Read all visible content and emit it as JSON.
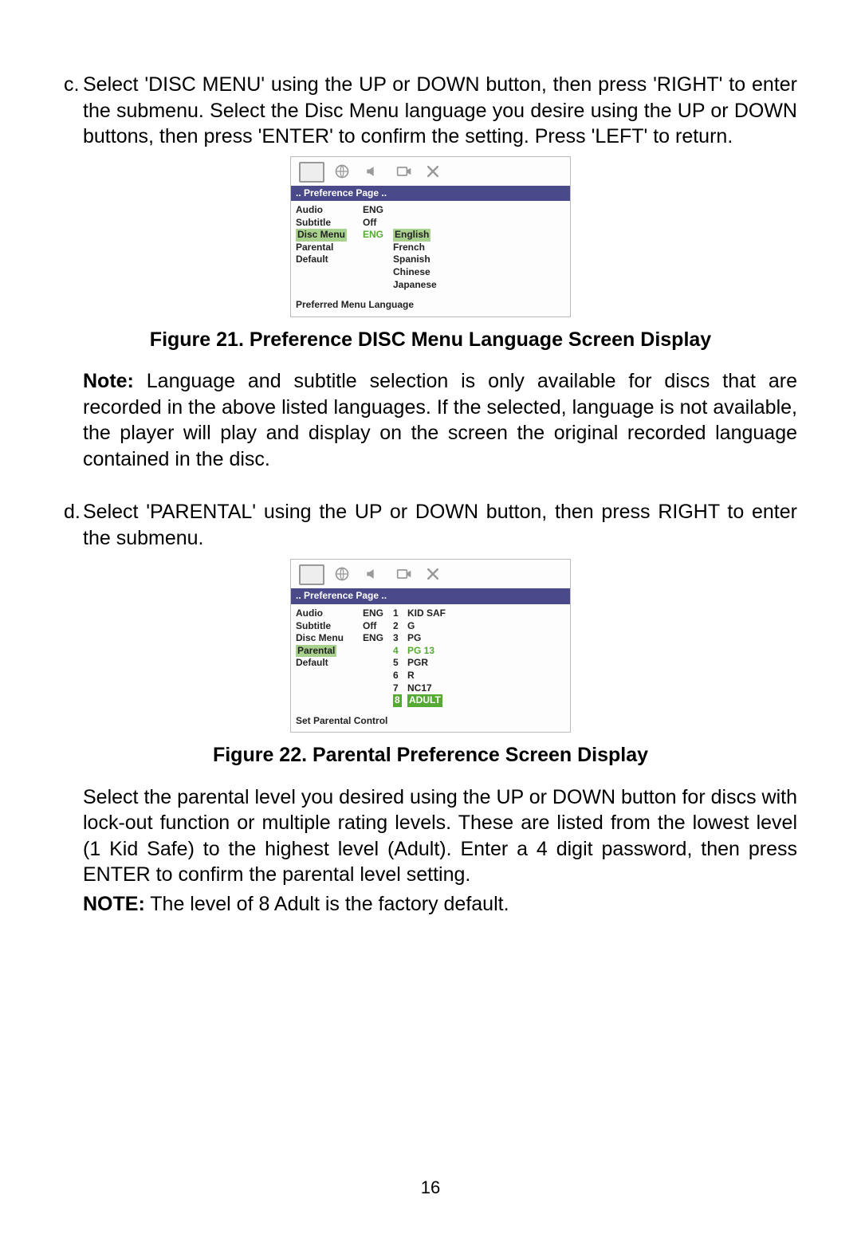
{
  "sectionC": {
    "marker": "c.",
    "text": "Select 'DISC MENU' using the UP or DOWN button, then press 'RIGHT' to enter the submenu. Select the Disc Menu language you desire using the UP or DOWN buttons, then press 'ENTER' to confirm the setting. Press 'LEFT' to return."
  },
  "fig21": {
    "header": "..  Preference  Page  ..",
    "rows": [
      {
        "label": "Audio",
        "val": "ENG",
        "opts": []
      },
      {
        "label": "Subtitle",
        "val": "Off",
        "opts": []
      },
      {
        "label": "Disc  Menu",
        "val": "ENG",
        "opts": [
          "English",
          "French",
          "Spanish",
          "Chinese",
          "Japanese"
        ],
        "hl": true
      },
      {
        "label": "Parental",
        "val": "",
        "opts": []
      },
      {
        "label": "Default",
        "val": "",
        "opts": []
      }
    ],
    "footer": "Preferred  Menu  Language",
    "caption": "Figure 21. Preference DISC Menu Language Screen Display"
  },
  "noteC": {
    "label": "Note:",
    "text": " Language and subtitle selection is only available for discs that are recorded in  the above listed languages.  If the selected, language is not available, the player will play and display on the screen the original recorded language contained in the disc."
  },
  "sectionD": {
    "marker": "d.",
    "text": "Select 'PARENTAL' using the UP or DOWN button, then press RIGHT to enter the submenu."
  },
  "fig22": {
    "header": "..  Preference  Page  ..",
    "rows": [
      {
        "label": "Audio",
        "val": "ENG",
        "num": "1",
        "opt": "KID  SAF"
      },
      {
        "label": "Subtitle",
        "val": "Off",
        "num": "2",
        "opt": "G"
      },
      {
        "label": "Disc  Menu",
        "val": "ENG",
        "num": "3",
        "opt": "PG"
      },
      {
        "label": "Parental",
        "val": "",
        "num": "4",
        "opt": "PG  13",
        "hl": true
      },
      {
        "label": "Default",
        "val": "",
        "num": "5",
        "opt": "PGR"
      },
      {
        "label": "",
        "val": "",
        "num": "6",
        "opt": "R"
      },
      {
        "label": "",
        "val": "",
        "num": "7",
        "opt": "NC17"
      },
      {
        "label": "",
        "val": "",
        "num": "8",
        "opt": "ADULT",
        "sel": true
      }
    ],
    "footer": "Set  Parental  Control",
    "caption": "Figure 22. Parental Preference Screen Display"
  },
  "paraD1": "Select the parental level you desired using the UP or DOWN button for discs with lock-out function or multiple rating levels. These are listed from the lowest level (1 Kid Safe) to the highest level (Adult). Enter a 4 digit password, then press ENTER to confirm the parental level setting.",
  "noteD": {
    "label": "NOTE:",
    "text": " The level of 8 Adult is the factory default."
  },
  "pageNumber": "16",
  "icons": {
    "screen": "screen-icon",
    "globe": "globe-icon",
    "speaker": "speaker-icon",
    "video": "video-icon",
    "x": "x-icon"
  }
}
